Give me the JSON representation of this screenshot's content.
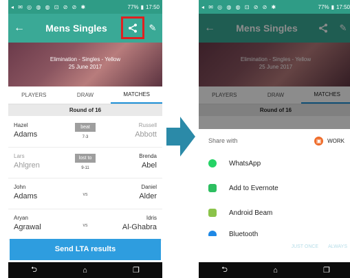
{
  "left": {
    "status_icons": "◂ ✉ ◎ ◍ ◍ ⊡ ⊘ ⊘ ✱",
    "status_battery": "77%",
    "status_time": "17:50",
    "title": "Mens Singles",
    "back": "←",
    "edit": "✎",
    "hero_line1": "Elimination - Singles - Yellow",
    "hero_line2": "25 June 2017",
    "tabs": [
      "PLAYERS",
      "DRAW",
      "MATCHES"
    ],
    "round": "Round of 16",
    "matches": [
      {
        "p1_first": "Hazel",
        "p1_last": "Adams",
        "badge": "beat",
        "center": "7-3",
        "p2_first": "Russell",
        "p2_last": "Abbott"
      },
      {
        "p1_first": "Lars",
        "p1_last": "Ahlgren",
        "badge": "lost to",
        "center": "9-11",
        "p2_first": "Brenda",
        "p2_last": "Abel"
      },
      {
        "p1_first": "John",
        "p1_last": "Adams",
        "badge": "",
        "center": "vs",
        "p2_first": "Daniel",
        "p2_last": "Alder"
      },
      {
        "p1_first": "Aryan",
        "p1_last": "Agrawal",
        "badge": "",
        "center": "vs",
        "p2_first": "Idris",
        "p2_last": "Al-Ghabra"
      }
    ],
    "send_button": "Send LTA results",
    "nav": [
      "⮌",
      "⌂",
      "❐"
    ]
  },
  "right": {
    "title": "Mens Singles",
    "hero_line1": "Elimination - Singles - Yellow",
    "hero_line2": "25 June 2017",
    "tabs": [
      "PLAYERS",
      "DRAW",
      "MATCHES"
    ],
    "round": "Round of 16",
    "share_with": "Share with",
    "work_label": "WORK",
    "apps": [
      {
        "label": "WhatsApp",
        "color": "#25d366"
      },
      {
        "label": "Add to Evernote",
        "color": "#2dbe60"
      },
      {
        "label": "Android Beam",
        "color": "#8bc34a"
      },
      {
        "label": "Bluetooth",
        "color": "#1e88e5"
      }
    ],
    "just_once": "JUST ONCE",
    "always": "ALWAYS"
  },
  "colors": {
    "appbar": "#3aa996",
    "accent_blue": "#2e9ddf",
    "highlight": "#e02020",
    "arrow": "#2b8aa8"
  }
}
